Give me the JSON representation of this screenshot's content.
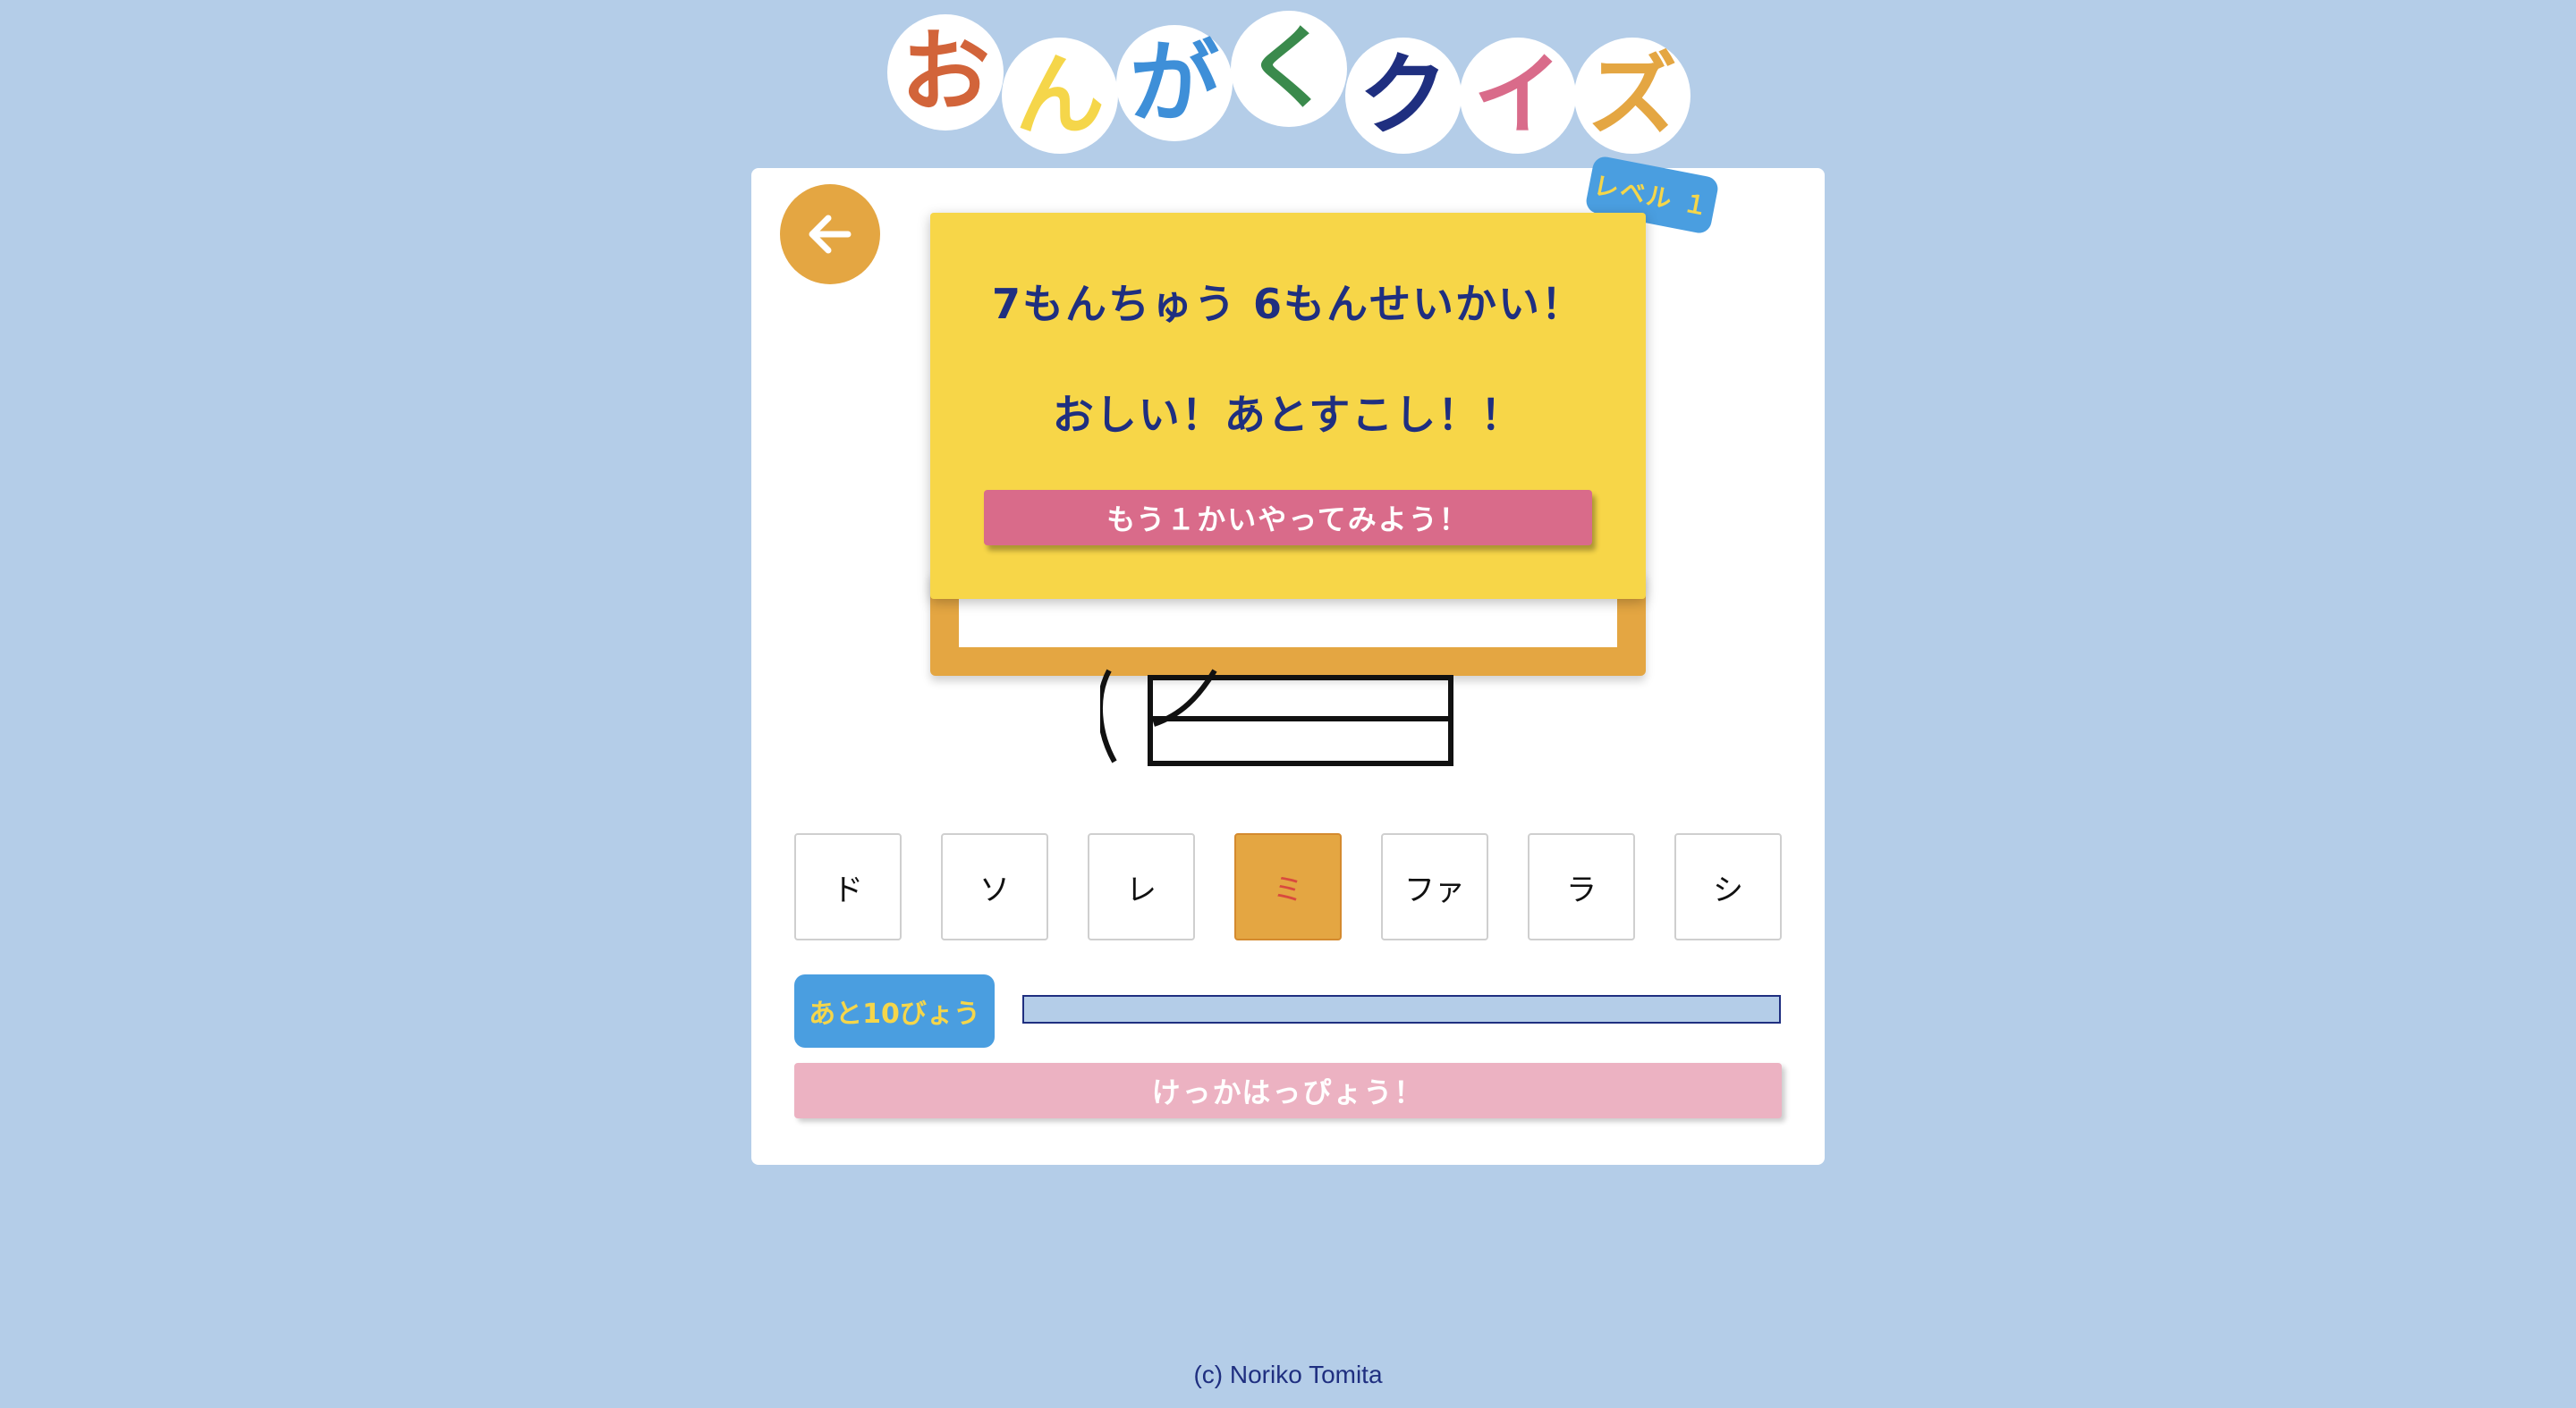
{
  "title": {
    "chars": [
      {
        "char": "お",
        "color": "#d2643a"
      },
      {
        "char": "ん",
        "color": "#f5d64a"
      },
      {
        "char": "が",
        "color": "#3e8fd8"
      },
      {
        "char": "く",
        "color": "#3a8a4c"
      },
      {
        "char": "ク",
        "color": "#1f2f80"
      },
      {
        "char": "イ",
        "color": "#d96b8a"
      },
      {
        "char": "ズ",
        "color": "#e4a642"
      }
    ]
  },
  "level": {
    "label": "レベル １"
  },
  "back": {
    "icon": "arrow-left-icon"
  },
  "popup": {
    "score_text": "7もんちゅう 6もんせいかい！",
    "message": "おしい！あとすこし！！",
    "retry_label": "もう１かいやってみよう！"
  },
  "answers": {
    "options": [
      "ド",
      "ソ",
      "レ",
      "ミ",
      "ファ",
      "ラ",
      "シ"
    ],
    "selected": "ミ"
  },
  "timer": {
    "label": "あと10びょう",
    "remaining_fraction": 1.0
  },
  "result": {
    "label": "けっかはっぴょう！"
  },
  "footer": {
    "text": "(c) Noriko Tomita"
  },
  "colors": {
    "background": "#b4cde8",
    "accent_orange": "#e4a642",
    "accent_blue": "#4a9ee0",
    "accent_yellow": "#f5d64a",
    "popup_yellow": "#f7d648",
    "pink": "#d96b8a",
    "light_pink": "#ecb2c2",
    "navy": "#1f2f80"
  }
}
